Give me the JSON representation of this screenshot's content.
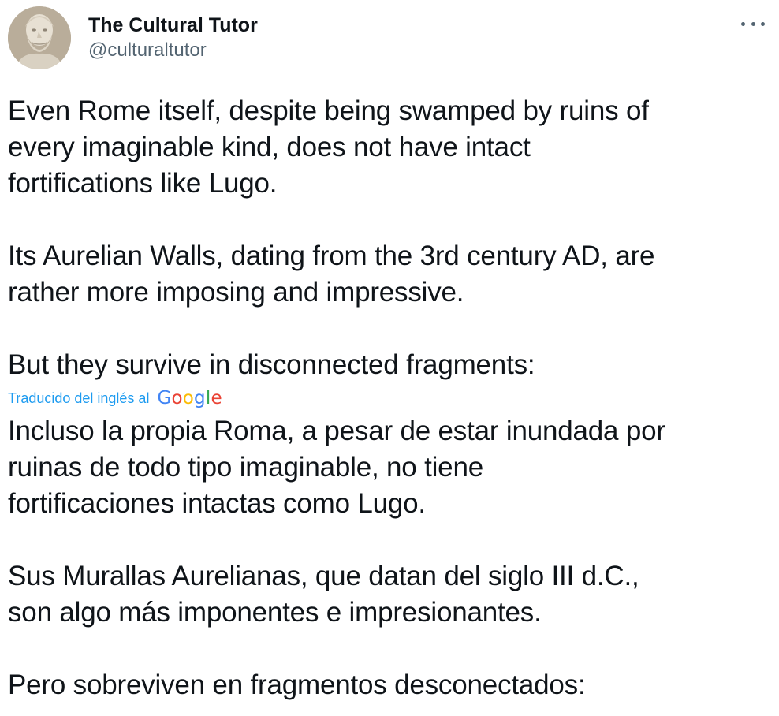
{
  "author": {
    "display_name": "The Cultural Tutor",
    "handle": "@culturaltutor"
  },
  "original_text": {
    "p1": "Even Rome itself, despite being swamped by ruins of\nevery imaginable kind, does not have intact\nfortifications like Lugo.",
    "p2": "Its Aurelian Walls, dating from the 3rd century AD, are\nrather more imposing and impressive.",
    "p3": "But they survive in disconnected fragments:"
  },
  "translation": {
    "label": "Traducido del inglés al",
    "provider_letters": [
      "G",
      "o",
      "o",
      "g",
      "l",
      "e"
    ],
    "p1": "Incluso la propia Roma, a pesar de estar inundada por\nruinas de todo tipo imaginable, no tiene\nfortificaciones intactas como Lugo.",
    "p2": "Sus Murallas Aurelianas, que datan del siglo III d.C.,\nson algo más imponentes e impresionantes.",
    "p3": "Pero sobreviven en fragmentos desconectados:"
  },
  "icons": {
    "more": "more-horizontal-icon",
    "avatar": "bust-statue-avatar"
  },
  "colors": {
    "text": "#0f1419",
    "secondary": "#536471",
    "link": "#1d9bf0"
  }
}
